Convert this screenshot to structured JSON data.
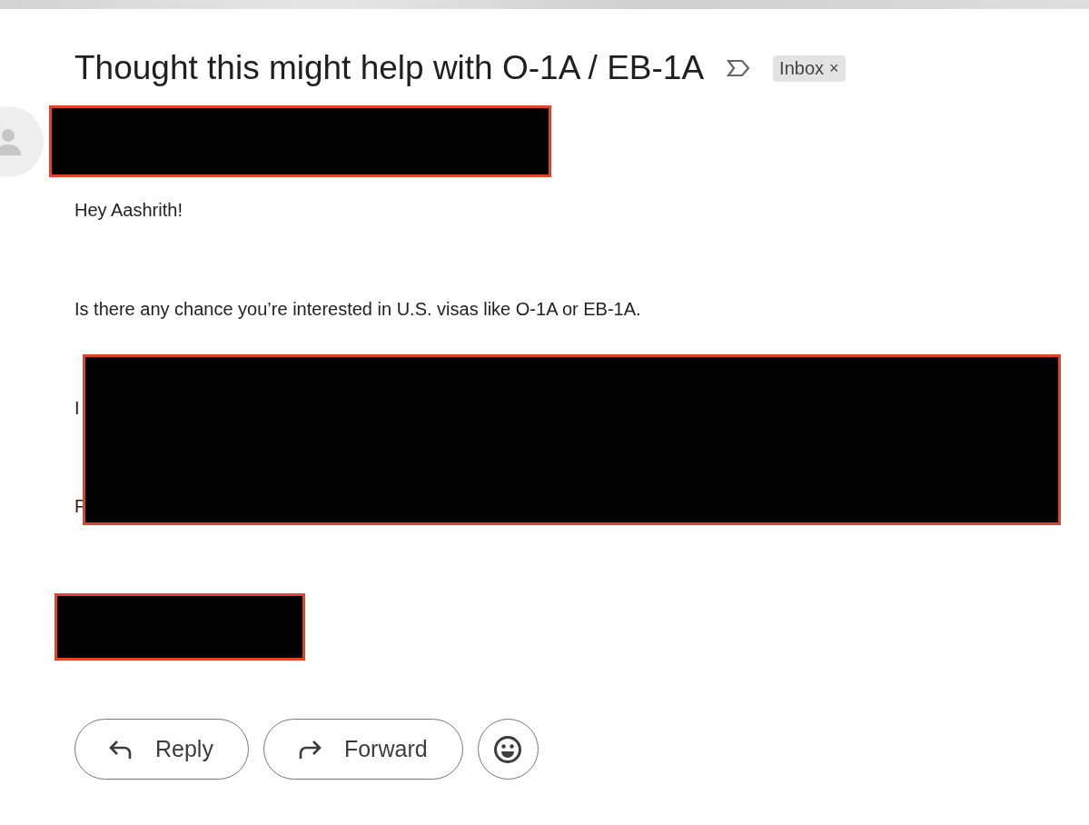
{
  "subject": "Thought this might help with O-1A / EB-1A",
  "labels": [
    {
      "text": "Inbox",
      "close": "×"
    }
  ],
  "sender": {
    "redacted": true
  },
  "body": [
    {
      "text": "Hey Aashrith!",
      "redacted": false
    },
    {
      "text": "Is there any chance you’re interested in U.S. visas like O-1A or EB-1A.",
      "redacted": false
    },
    {
      "text": "I",
      "redacted": true
    },
    {
      "text": "F",
      "redacted": true
    }
  ],
  "signature": {
    "redacted": true
  },
  "actions": [
    {
      "label": "Reply",
      "kind": "reply"
    },
    {
      "label": "Forward",
      "kind": "forward"
    },
    {
      "kind": "emoji"
    }
  ]
}
